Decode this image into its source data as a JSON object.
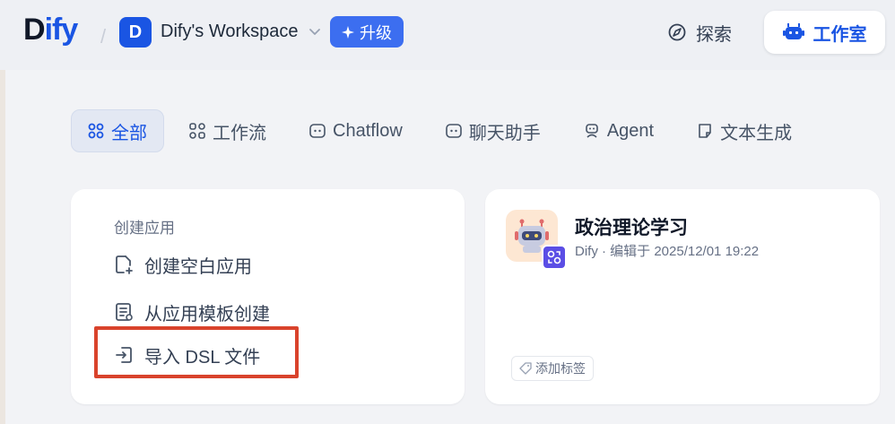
{
  "header": {
    "logo_prefix": "D",
    "logo_highlight": "ify",
    "workspace_initial": "D",
    "workspace_name": "Dify's Workspace",
    "upgrade_label": "升级",
    "explore_label": "探索",
    "studio_label": "工作室"
  },
  "tabs": [
    {
      "label": "全部",
      "icon": "grid-icon",
      "active": true
    },
    {
      "label": "工作流",
      "icon": "workflow-icon"
    },
    {
      "label": "Chatflow",
      "icon": "chatflow-icon"
    },
    {
      "label": "聊天助手",
      "icon": "chat-bubble-icon"
    },
    {
      "label": "Agent",
      "icon": "agent-icon"
    },
    {
      "label": "文本生成",
      "icon": "document-icon"
    }
  ],
  "create_card": {
    "title": "创建应用",
    "items": [
      {
        "label": "创建空白应用",
        "icon": "file-plus-icon"
      },
      {
        "label": "从应用模板创建",
        "icon": "template-icon"
      },
      {
        "label": "导入 DSL 文件",
        "icon": "import-icon"
      }
    ]
  },
  "app_card": {
    "name": "政治理论学习",
    "meta": "Dify · 编辑于 2025/12/01 19:22",
    "tag_label": "添加标签"
  },
  "colors": {
    "accent": "#1a55e3",
    "highlight_border": "#d9432c"
  }
}
